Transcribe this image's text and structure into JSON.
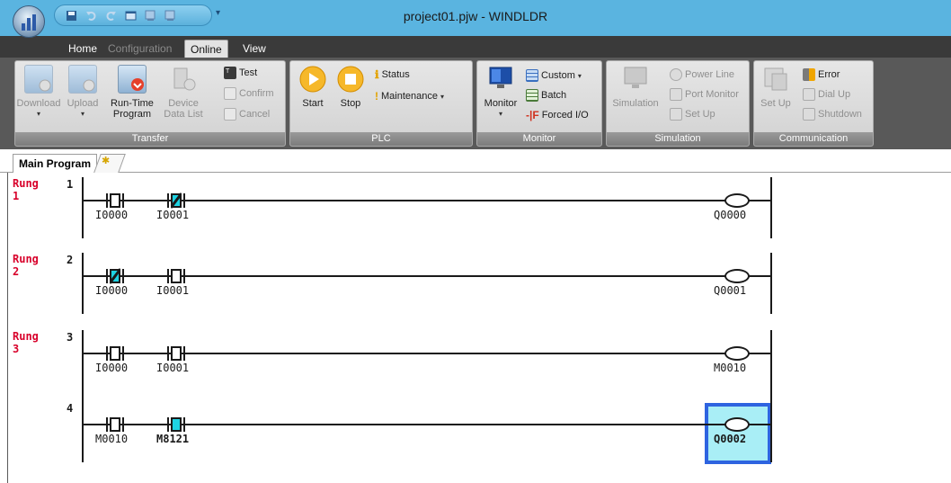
{
  "window": {
    "title": "project01.pjw - WINDLDR"
  },
  "qat": {
    "icons": [
      "save-icon",
      "undo-icon",
      "redo-icon",
      "window-icon",
      "download-icon",
      "upload-icon"
    ],
    "more": "▾"
  },
  "ribbon_tabs": [
    {
      "label": "Home",
      "state": "enabled"
    },
    {
      "label": "Configuration",
      "state": "disabled"
    },
    {
      "label": "Online",
      "state": "active"
    },
    {
      "label": "View",
      "state": "enabled"
    }
  ],
  "groups": {
    "transfer": {
      "title": "Transfer",
      "download": "Download",
      "upload": "Upload",
      "runtime_line1": "Run-Time",
      "runtime_line2": "Program",
      "device_line1": "Device",
      "device_line2": "Data List",
      "test": "Test",
      "confirm": "Confirm",
      "cancel": "Cancel"
    },
    "plc": {
      "title": "PLC",
      "start": "Start",
      "stop": "Stop",
      "status": "Status",
      "maintenance": "Maintenance"
    },
    "monitor": {
      "title": "Monitor",
      "monitor": "Monitor",
      "custom": "Custom",
      "batch": "Batch",
      "forced_io": "Forced I/O"
    },
    "simulation": {
      "title": "Simulation",
      "simulation": "Simulation",
      "power_line": "Power Line",
      "port_monitor": "Port Monitor",
      "set_up": "Set Up"
    },
    "communication": {
      "title": "Communication",
      "set_up": "Set Up",
      "error": "Error",
      "dial_up": "Dial Up",
      "shutdown": "Shutdown"
    }
  },
  "doc_tabs": {
    "main": "Main Program"
  },
  "ladder": {
    "rung_word": "Rung",
    "rungs": [
      {
        "number": "1",
        "lines": [
          {
            "index": "1",
            "contacts": [
              {
                "operand": "I0000",
                "type": "NO",
                "state": "off"
              },
              {
                "operand": "I0001",
                "type": "NC",
                "state": "on"
              }
            ],
            "coil": "Q0000"
          }
        ]
      },
      {
        "number": "2",
        "lines": [
          {
            "index": "2",
            "contacts": [
              {
                "operand": "I0000",
                "type": "NC",
                "state": "on"
              },
              {
                "operand": "I0001",
                "type": "NO",
                "state": "off"
              }
            ],
            "coil": "Q0001"
          }
        ]
      },
      {
        "number": "3",
        "lines": [
          {
            "index": "3",
            "contacts": [
              {
                "operand": "I0000",
                "type": "NO",
                "state": "off"
              },
              {
                "operand": "I0001",
                "type": "NO",
                "state": "off"
              }
            ],
            "coil": "M0010"
          },
          {
            "index": "4",
            "contacts": [
              {
                "operand": "M0010",
                "type": "NO",
                "state": "off"
              },
              {
                "operand": "M8121",
                "type": "NO",
                "state": "on"
              }
            ],
            "coil": "Q0002"
          }
        ]
      }
    ]
  },
  "colors": {
    "titlebar": "#5ab4e0",
    "rung_label": "#d8002a",
    "contact_on": "#1ed3e3",
    "selection": "#2e64e0"
  }
}
